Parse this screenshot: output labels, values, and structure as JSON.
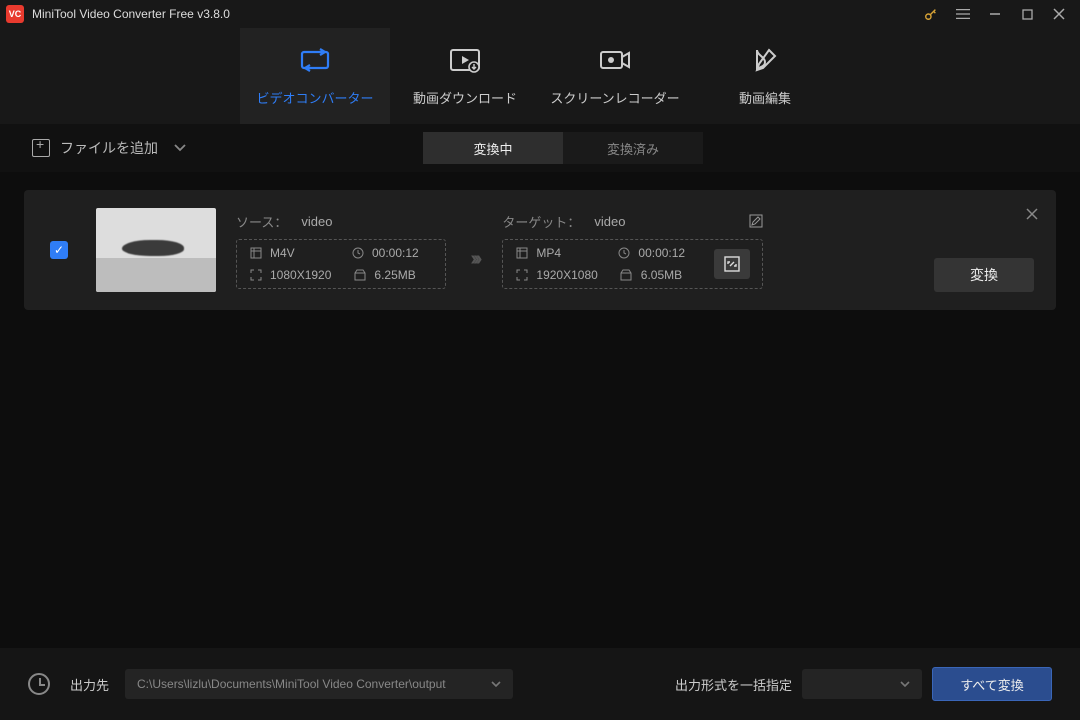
{
  "titlebar": {
    "title": "MiniTool Video Converter Free v3.8.0"
  },
  "tabs": {
    "converter": "ビデオコンバーター",
    "download": "動画ダウンロード",
    "recorder": "スクリーンレコーダー",
    "edit": "動画編集"
  },
  "toolbar": {
    "add_file": "ファイルを追加",
    "converting": "変換中",
    "converted": "変換済み"
  },
  "card": {
    "source_label": "ソース：",
    "source_name": "video",
    "target_label": "ターゲット：",
    "target_name": "video",
    "src": {
      "format": "M4V",
      "duration": "00:00:12",
      "resolution": "1080X1920",
      "size": "6.25MB"
    },
    "tgt": {
      "format": "MP4",
      "duration": "00:00:12",
      "resolution": "1920X1080",
      "size": "6.05MB"
    },
    "convert_btn": "変換"
  },
  "footer": {
    "output_label": "出力先",
    "output_path": "C:\\Users\\lizlu\\Documents\\MiniTool Video Converter\\output",
    "format_all_label": "出力形式を一括指定",
    "convert_all": "すべて変換"
  }
}
